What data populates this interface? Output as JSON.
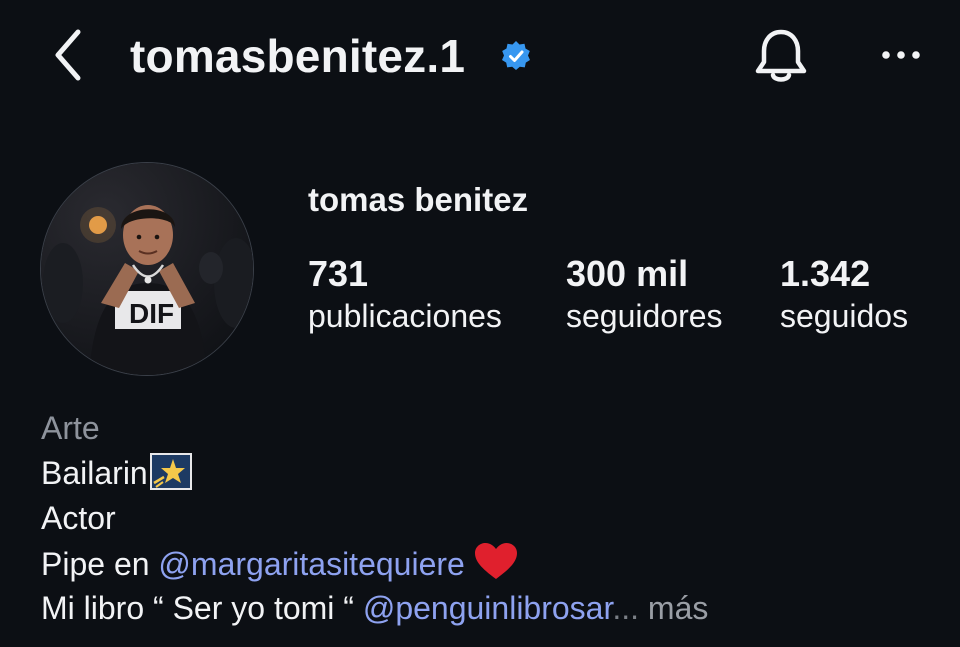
{
  "header": {
    "username": "tomasbenitez.1",
    "icons": {
      "back": "chevron-left-icon",
      "verified": "verified-badge-icon",
      "notifications": "bell-icon",
      "more": "more-horizontal-icon"
    },
    "verified_color": "#3797f0"
  },
  "profile": {
    "display_name": "tomas benitez",
    "avatar": "profile-photo",
    "stats": [
      {
        "value": "731",
        "label": "publicaciones"
      },
      {
        "value": "300 mil",
        "label": "seguidores"
      },
      {
        "value": "1.342",
        "label": "seguidos"
      }
    ]
  },
  "bio": {
    "category": "Arte",
    "line1": "Bailarin",
    "line2": "Actor",
    "line3_prefix": "Pipe en ",
    "line3_mention": "@margaritasitequiere",
    "line4_prefix": "Mi libro “ Ser yo tomi “ ",
    "line4_mention": "@penguinlibrosar",
    "ellipsis": "...",
    "more_label": " más",
    "mention_color": "#8ea2f0"
  }
}
